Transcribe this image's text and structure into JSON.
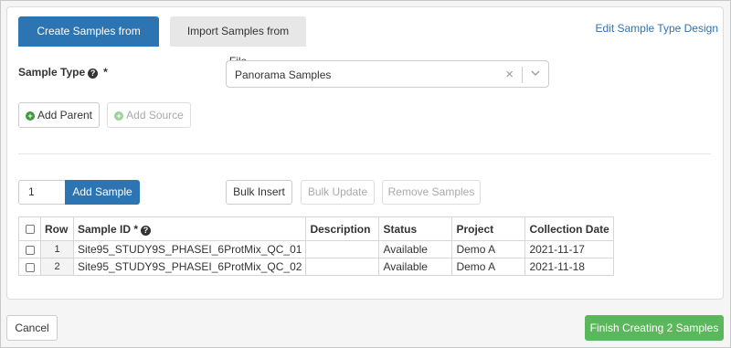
{
  "tabs": {
    "create_grid": "Create Samples from Grid",
    "import_file": "Import Samples from File"
  },
  "edit_link": "Edit Sample Type Design",
  "sample_type": {
    "label": "Sample Type",
    "required_marker": "*",
    "value": "Panorama Samples"
  },
  "buttons": {
    "add_parent": "Add Parent",
    "add_source": "Add Source",
    "add_sample": "Add Sample",
    "bulk_insert": "Bulk Insert",
    "bulk_update": "Bulk Update",
    "remove_samples": "Remove Samples",
    "cancel": "Cancel",
    "finish": "Finish Creating 2 Samples"
  },
  "quantity": "1",
  "grid": {
    "headers": {
      "row": "Row",
      "sample_id": "Sample ID",
      "sample_id_req": "*",
      "description": "Description",
      "status": "Status",
      "project": "Project",
      "collection_date": "Collection Date"
    },
    "rows": [
      {
        "row": "1",
        "sample_id": "Site95_STUDY9S_PHASEI_6ProtMix_QC_01",
        "description": "",
        "status": "Available",
        "project": "Demo A",
        "collection_date": "2021-11-17"
      },
      {
        "row": "2",
        "sample_id": "Site95_STUDY9S_PHASEI_6ProtMix_QC_02",
        "description": "",
        "status": "Available",
        "project": "Demo A",
        "collection_date": "2021-11-18"
      }
    ]
  }
}
